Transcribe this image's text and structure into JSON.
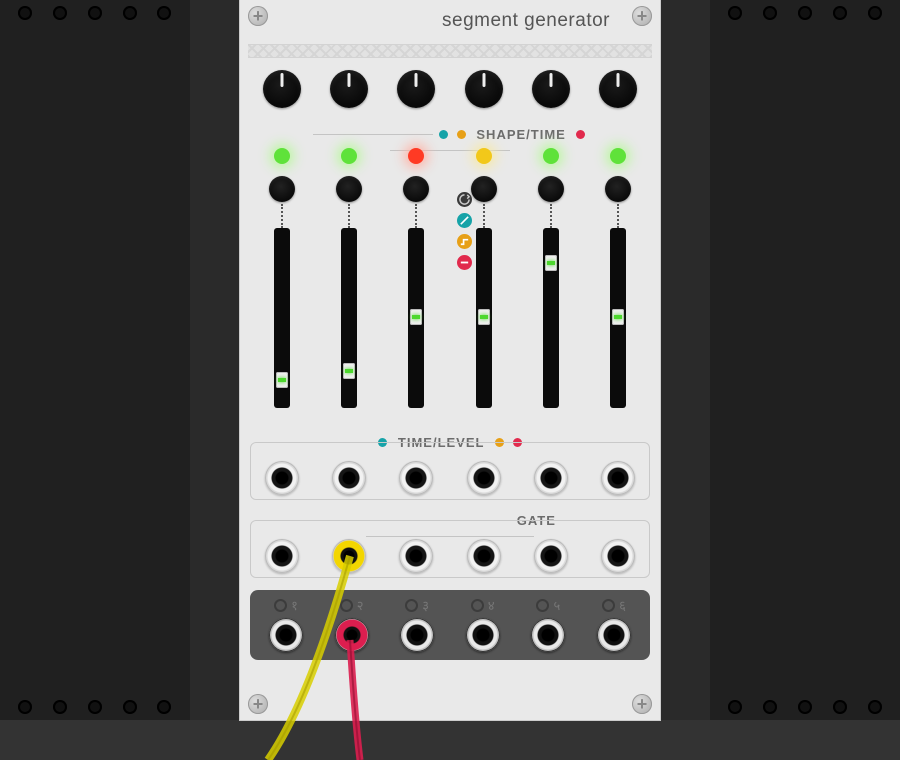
{
  "title": "segment generator",
  "labels": {
    "shape_time": "SHAPE/TIME",
    "time_level": "TIME/LEVEL",
    "gate": "GATE"
  },
  "dot_colors": {
    "teal": "#16a3a8",
    "orange": "#e7a017",
    "red": "#e12a4d"
  },
  "led_colors": [
    "#5fe23a",
    "#5fe23a",
    "#ff3a24",
    "#f2c81a",
    "#5fe23a",
    "#5fe23a"
  ],
  "slider_values": [
    0.8,
    0.75,
    0.45,
    0.45,
    0.15,
    0.45
  ],
  "output_numerals": [
    "१",
    "२",
    "३",
    "४",
    "५",
    "६"
  ],
  "plugged": {
    "gate_index": 1,
    "gate_color": "yellow",
    "out_index": 1,
    "out_color": "red"
  },
  "mode_icons": [
    {
      "name": "loop-icon",
      "bg": "#3a3a3a"
    },
    {
      "name": "ramp-icon",
      "bg": "#16a3a8"
    },
    {
      "name": "step-icon",
      "bg": "#e7a017"
    },
    {
      "name": "hold-icon",
      "bg": "#e12a4d"
    }
  ]
}
